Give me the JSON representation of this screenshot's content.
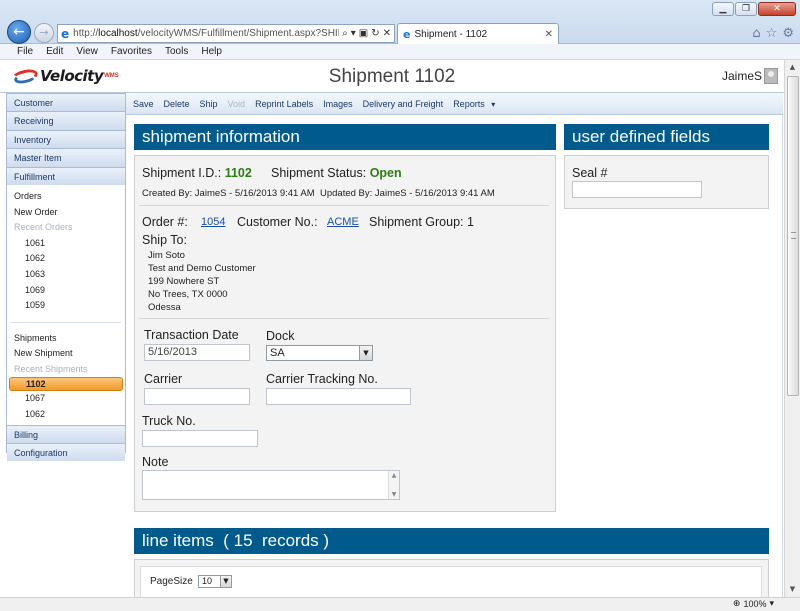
{
  "browser": {
    "address_prefix": "http://",
    "address_host": "localhost",
    "address_rest": "/velocityWMS/Fulfillment/Shipment.aspx?SHIPMENT_",
    "tab_title": "Shipment - 1102",
    "menu": [
      "File",
      "Edit",
      "View",
      "Favorites",
      "Tools",
      "Help"
    ],
    "zoom": "100%"
  },
  "app": {
    "logo_word": "Velocity",
    "logo_sup": "WMS",
    "page_title": "Shipment 1102",
    "user": "JaimeS"
  },
  "sidebar": {
    "customer": "Customer",
    "receiving": "Receiving",
    "inventory": "Inventory",
    "master_item": "Master Item",
    "fulfillment": "Fulfillment",
    "orders": "Orders",
    "new_order": "New Order",
    "recent_orders": "Recent Orders",
    "order_list": [
      "1061",
      "1062",
      "1063",
      "1069",
      "1059"
    ],
    "shipments": "Shipments",
    "new_shipment": "New Shipment",
    "recent_shipments": "Recent Shipments",
    "shipment_list": [
      "1102",
      "1067",
      "1062"
    ],
    "billing": "Billing",
    "configuration": "Configuration"
  },
  "toolbar": {
    "save": "Save",
    "delete": "Delete",
    "ship": "Ship",
    "void": "Void",
    "reprint": "Reprint Labels",
    "images": "Images",
    "delivery": "Delivery and Freight",
    "reports": "Reports",
    "reports_caret": "▾"
  },
  "shipment": {
    "header": "shipment information",
    "id_label": "Shipment I.D.:",
    "id_value": "1102",
    "status_label": "Shipment Status:",
    "status_value": "Open",
    "created": "Created By: JaimeS - 5/16/2013 9:41 AM",
    "updated": "Updated By: JaimeS - 5/16/2013 9:41 AM",
    "order_label": "Order #:",
    "order_value": "1054",
    "customer_label": "Customer No.:",
    "customer_value": "ACME",
    "group_label": "Shipment Group:",
    "group_value": "1",
    "ship_to_label": "Ship To:",
    "ship_to": [
      "Jim Soto",
      "Test and Demo Customer",
      "199 Nowhere ST",
      "No Trees, TX 0000",
      "Odessa"
    ],
    "transaction_date_label": "Transaction Date",
    "transaction_date_value": "5/16/2013",
    "dock_label": "Dock",
    "dock_value": "SA",
    "carrier_label": "Carrier",
    "carrier_value": "",
    "tracking_label": "Carrier Tracking No.",
    "tracking_value": "",
    "truck_label": "Truck No.",
    "truck_value": "",
    "note_label": "Note"
  },
  "udf": {
    "header": "user defined fields",
    "seal_label": "Seal #",
    "seal_value": ""
  },
  "line_items": {
    "header": "line items  ( 15  records )",
    "pagesize_label": "PageSize",
    "pagesize_value": "10"
  }
}
